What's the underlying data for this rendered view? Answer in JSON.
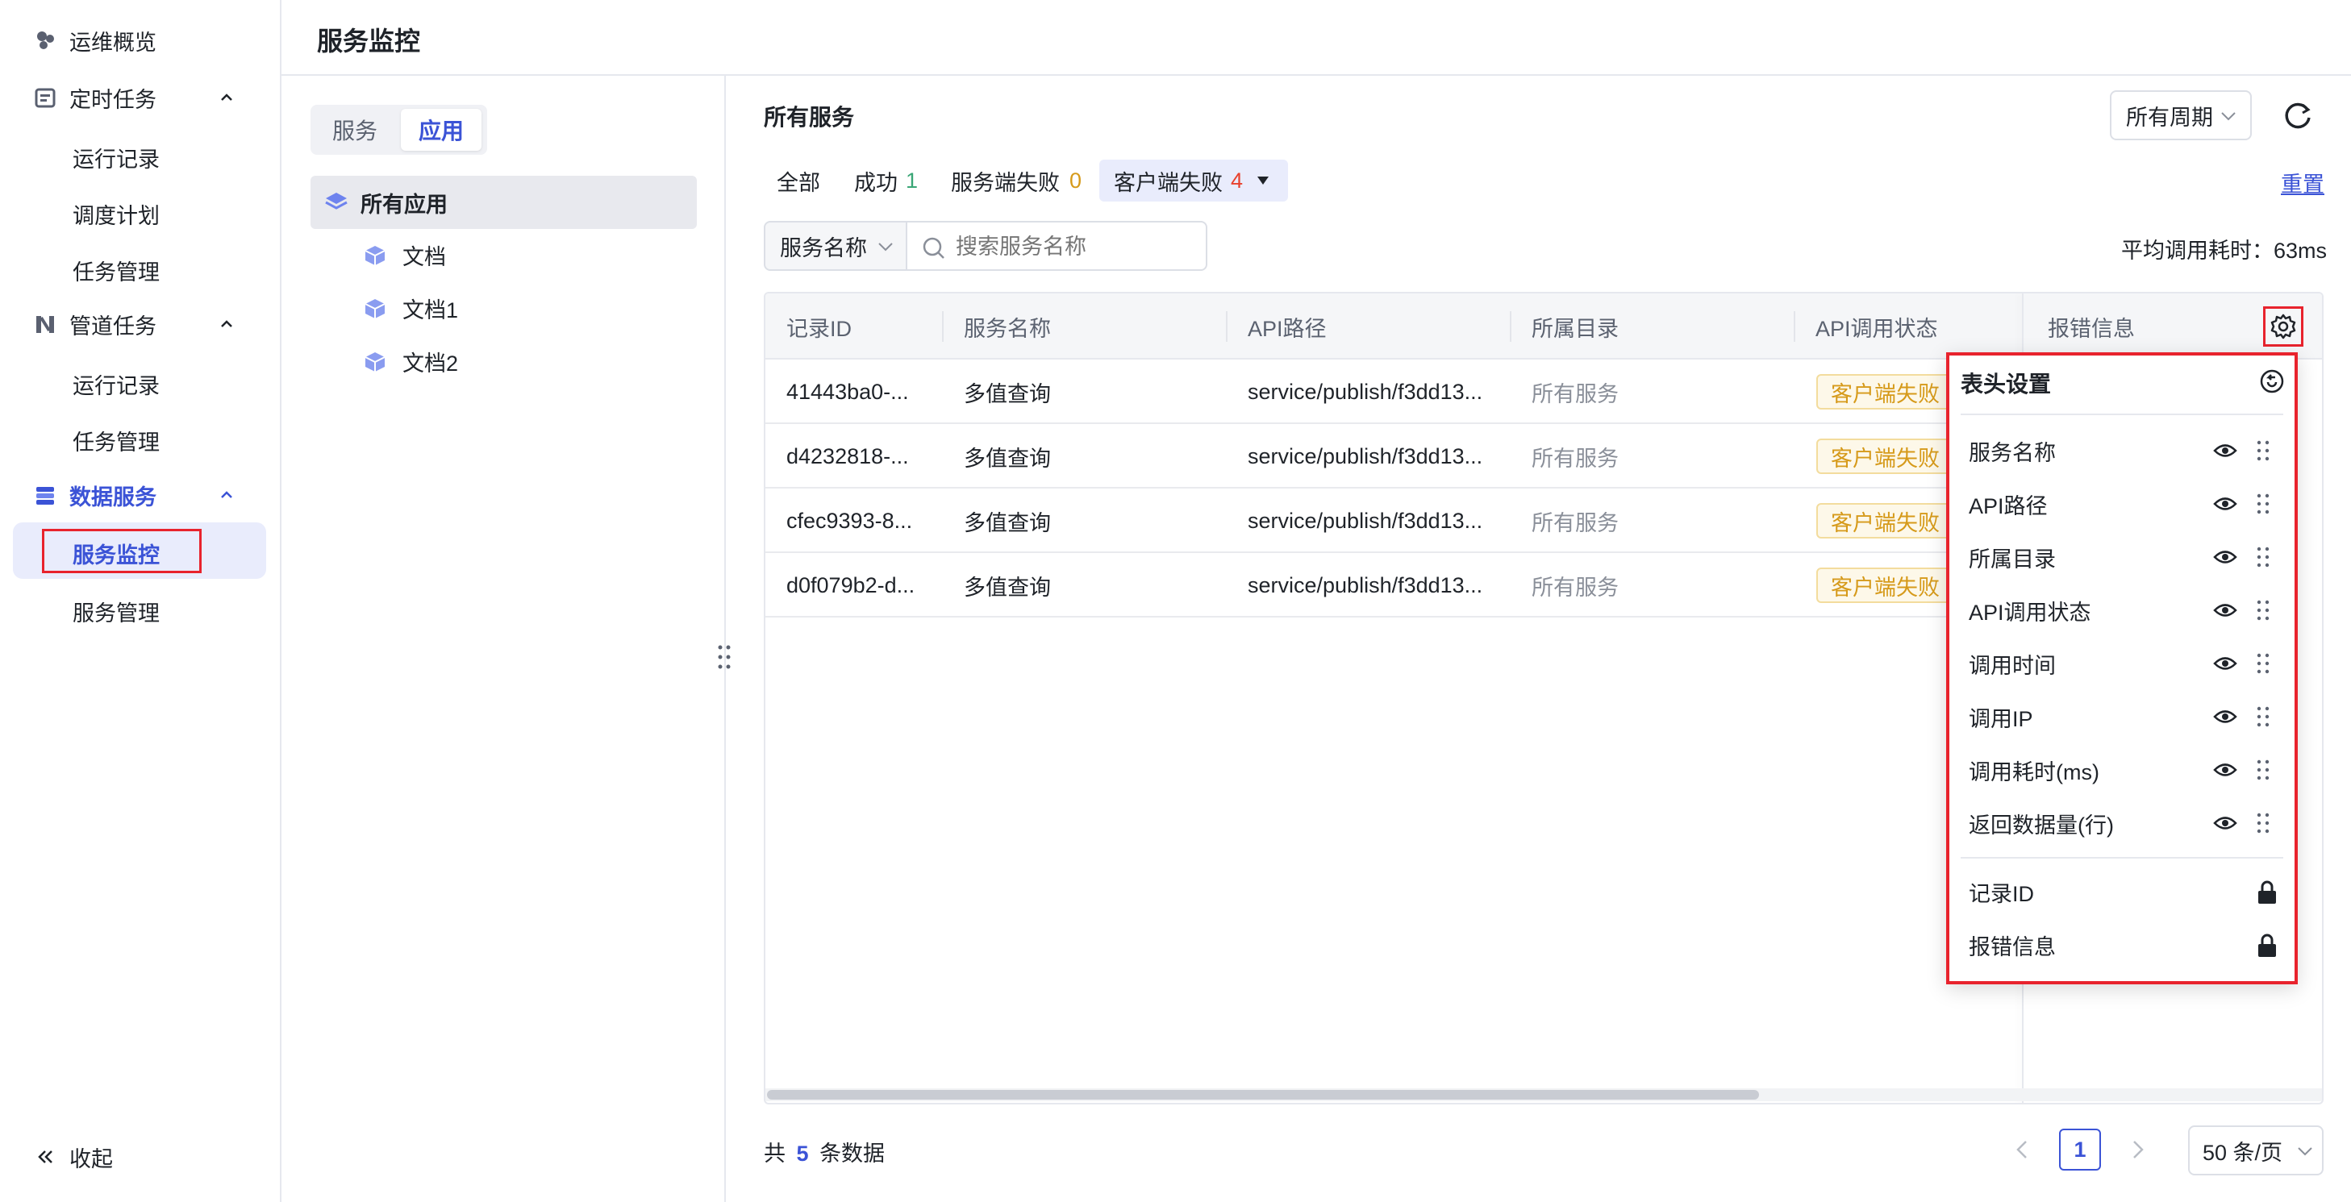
{
  "sidebar": {
    "items": [
      {
        "label": "运维概览",
        "icon": "dashboard-icon"
      },
      {
        "label": "定时任务",
        "icon": "scheduled-task-icon"
      },
      {
        "label": "运行记录"
      },
      {
        "label": "调度计划"
      },
      {
        "label": "任务管理"
      },
      {
        "label": "管道任务",
        "icon": "pipeline-icon"
      },
      {
        "label": "运行记录"
      },
      {
        "label": "任务管理"
      },
      {
        "label": "数据服务",
        "icon": "data-service-icon"
      },
      {
        "label": "服务监控"
      },
      {
        "label": "服务管理"
      }
    ],
    "collapse_label": "收起"
  },
  "header": {
    "title": "服务监控"
  },
  "tree": {
    "segments": [
      "服务",
      "应用"
    ],
    "active_segment": "应用",
    "root": "所有应用",
    "children": [
      "文档",
      "文档1",
      "文档2"
    ]
  },
  "main": {
    "title": "所有服务",
    "period_select": "所有周期",
    "tabs": [
      {
        "label": "全部",
        "count": ""
      },
      {
        "label": "成功",
        "count": "1"
      },
      {
        "label": "服务端失败",
        "count": "0"
      },
      {
        "label": "客户端失败",
        "count": "4"
      }
    ],
    "reset_label": "重置",
    "search_field_select": "服务名称",
    "search_placeholder": "搜索服务名称",
    "avg_label": "平均调用耗时：63ms",
    "columns": [
      "记录ID",
      "服务名称",
      "API路径",
      "所属目录",
      "API调用状态",
      "报错信息"
    ],
    "rows": [
      {
        "id": "41443ba0-...",
        "name": "多值查询",
        "path": "service/publish/f3dd13...",
        "dir": "所有服务",
        "status": "客户端失败"
      },
      {
        "id": "d4232818-...",
        "name": "多值查询",
        "path": "service/publish/f3dd13...",
        "dir": "所有服务",
        "status": "客户端失败"
      },
      {
        "id": "cfec9393-8...",
        "name": "多值查询",
        "path": "service/publish/f3dd13...",
        "dir": "所有服务",
        "status": "客户端失败"
      },
      {
        "id": "d0f079b2-d...",
        "name": "多值查询",
        "path": "service/publish/f3dd13...",
        "dir": "所有服务",
        "status": "客户端失败"
      }
    ],
    "footer": {
      "total_prefix": "共",
      "total": "5",
      "total_suffix": "条数据",
      "page": "1",
      "page_size": "50 条/页"
    }
  },
  "column_settings": {
    "title": "表头设置",
    "visible_columns": [
      "服务名称",
      "API路径",
      "所属目录",
      "API调用状态",
      "调用时间",
      "调用IP",
      "调用耗时(ms)",
      "返回数据量(行)"
    ],
    "locked_columns": [
      "记录ID",
      "报错信息"
    ]
  },
  "colors": {
    "accent": "#3b53d6",
    "success": "#3aa676",
    "warning": "#d69a1a",
    "danger": "#e8412d"
  }
}
